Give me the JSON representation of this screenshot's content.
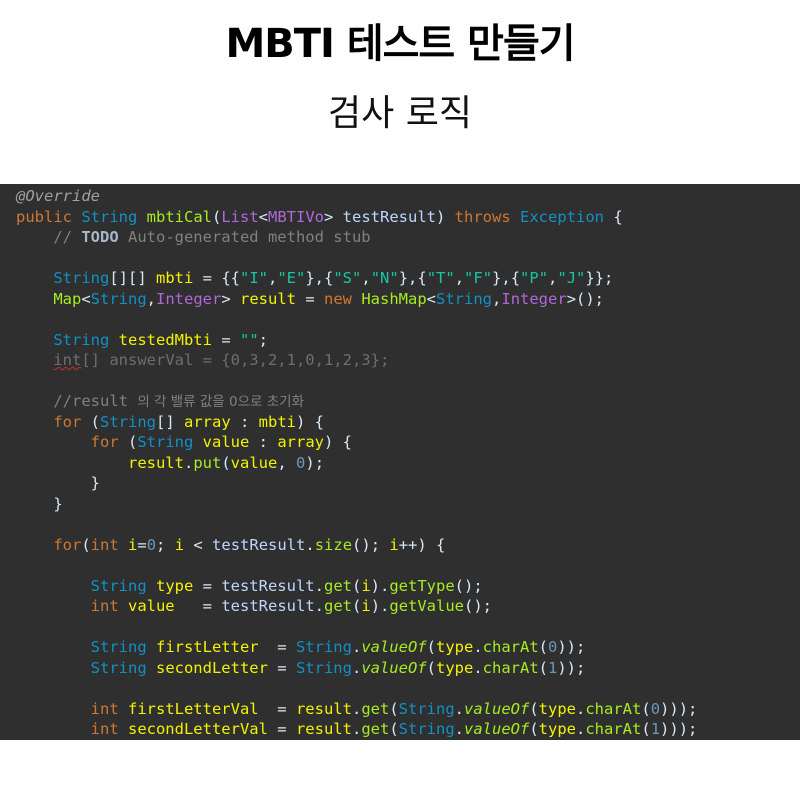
{
  "title": "MBTI 테스트 만들기",
  "subtitle": "검사 로직",
  "code": {
    "background": "#2f2f2f",
    "lines": [
      [
        {
          "c": "ann",
          "t": "@Override"
        }
      ],
      [
        {
          "c": "kw",
          "t": "public "
        },
        {
          "c": "ty",
          "t": "String "
        },
        {
          "c": "fn",
          "t": "mbtiCal"
        },
        {
          "c": "pl",
          "t": "("
        },
        {
          "c": "pink",
          "t": "List"
        },
        {
          "c": "pl",
          "t": "<"
        },
        {
          "c": "pink",
          "t": "MBTIVo"
        },
        {
          "c": "pl",
          "t": "> "
        },
        {
          "c": "gen",
          "t": "testResult"
        },
        {
          "c": "pl",
          "t": ") "
        },
        {
          "c": "kw",
          "t": "throws "
        },
        {
          "c": "ty",
          "t": "Exception "
        },
        {
          "c": "pl",
          "t": "{"
        }
      ],
      [
        {
          "c": "cm",
          "t": "    // "
        },
        {
          "c": "todo",
          "t": "TODO"
        },
        {
          "c": "cm",
          "t": " Auto-generated method stub"
        }
      ],
      [],
      [
        {
          "c": "pl",
          "t": "    "
        },
        {
          "c": "ty",
          "t": "String"
        },
        {
          "c": "pl",
          "t": "[][] "
        },
        {
          "c": "var",
          "t": "mbti"
        },
        {
          "c": "pl",
          "t": " = {{"
        },
        {
          "c": "str",
          "t": "\"I\""
        },
        {
          "c": "pl",
          "t": ","
        },
        {
          "c": "str",
          "t": "\"E\""
        },
        {
          "c": "pl",
          "t": "},{"
        },
        {
          "c": "str",
          "t": "\"S\""
        },
        {
          "c": "pl",
          "t": ","
        },
        {
          "c": "str",
          "t": "\"N\""
        },
        {
          "c": "pl",
          "t": "},{"
        },
        {
          "c": "str",
          "t": "\"T\""
        },
        {
          "c": "pl",
          "t": ","
        },
        {
          "c": "str",
          "t": "\"F\""
        },
        {
          "c": "pl",
          "t": "},{"
        },
        {
          "c": "str",
          "t": "\"P\""
        },
        {
          "c": "pl",
          "t": ","
        },
        {
          "c": "str",
          "t": "\"J\""
        },
        {
          "c": "pl",
          "t": "}};"
        }
      ],
      [
        {
          "c": "pl",
          "t": "    "
        },
        {
          "c": "fn",
          "t": "Map"
        },
        {
          "c": "pl",
          "t": "<"
        },
        {
          "c": "ty",
          "t": "String"
        },
        {
          "c": "pl",
          "t": ","
        },
        {
          "c": "pink",
          "t": "Integer"
        },
        {
          "c": "pl",
          "t": "> "
        },
        {
          "c": "var",
          "t": "result"
        },
        {
          "c": "pl",
          "t": " = "
        },
        {
          "c": "kw",
          "t": "new "
        },
        {
          "c": "fn",
          "t": "HashMap"
        },
        {
          "c": "pl",
          "t": "<"
        },
        {
          "c": "ty",
          "t": "String"
        },
        {
          "c": "pl",
          "t": ","
        },
        {
          "c": "pink",
          "t": "Integer"
        },
        {
          "c": "pl",
          "t": ">();"
        }
      ],
      [],
      [
        {
          "c": "pl",
          "t": "    "
        },
        {
          "c": "ty",
          "t": "String "
        },
        {
          "c": "var",
          "t": "testedMbti"
        },
        {
          "c": "pl",
          "t": " = "
        },
        {
          "c": "str",
          "t": "\"\""
        },
        {
          "c": "pl",
          "t": ";"
        }
      ],
      [
        {
          "c": "pl",
          "t": "    "
        },
        {
          "c": "dim sq",
          "t": "int"
        },
        {
          "c": "dim",
          "t": "[] answerVal = {0,3,2,1,0,1,2,3};"
        }
      ],
      [],
      [
        {
          "c": "cm",
          "t": "    //result "
        },
        {
          "c": "cmk",
          "t": "의 각 밸류 값을 0으로 초기화"
        }
      ],
      [
        {
          "c": "pl",
          "t": "    "
        },
        {
          "c": "kw",
          "t": "for "
        },
        {
          "c": "pl",
          "t": "("
        },
        {
          "c": "ty",
          "t": "String"
        },
        {
          "c": "pl",
          "t": "[] "
        },
        {
          "c": "var",
          "t": "array"
        },
        {
          "c": "pl",
          "t": " : "
        },
        {
          "c": "var",
          "t": "mbti"
        },
        {
          "c": "pl",
          "t": ") {"
        }
      ],
      [
        {
          "c": "pl",
          "t": "        "
        },
        {
          "c": "kw",
          "t": "for "
        },
        {
          "c": "pl",
          "t": "("
        },
        {
          "c": "ty",
          "t": "String "
        },
        {
          "c": "var",
          "t": "value"
        },
        {
          "c": "pl",
          "t": " : "
        },
        {
          "c": "var",
          "t": "array"
        },
        {
          "c": "pl",
          "t": ") {"
        }
      ],
      [
        {
          "c": "pl",
          "t": "            "
        },
        {
          "c": "var",
          "t": "result"
        },
        {
          "c": "pl",
          "t": "."
        },
        {
          "c": "fn",
          "t": "put"
        },
        {
          "c": "pl",
          "t": "("
        },
        {
          "c": "var",
          "t": "value"
        },
        {
          "c": "pl",
          "t": ", "
        },
        {
          "c": "num",
          "t": "0"
        },
        {
          "c": "pl",
          "t": ");"
        }
      ],
      [
        {
          "c": "pl",
          "t": "        }"
        }
      ],
      [
        {
          "c": "pl",
          "t": "    }"
        }
      ],
      [],
      [
        {
          "c": "pl",
          "t": "    "
        },
        {
          "c": "kw",
          "t": "for"
        },
        {
          "c": "pl",
          "t": "("
        },
        {
          "c": "kw",
          "t": "int "
        },
        {
          "c": "var",
          "t": "i"
        },
        {
          "c": "pl",
          "t": "="
        },
        {
          "c": "num",
          "t": "0"
        },
        {
          "c": "pl",
          "t": "; "
        },
        {
          "c": "var",
          "t": "i"
        },
        {
          "c": "pl",
          "t": " < "
        },
        {
          "c": "gen",
          "t": "testResult"
        },
        {
          "c": "pl",
          "t": "."
        },
        {
          "c": "fn",
          "t": "size"
        },
        {
          "c": "pl",
          "t": "(); "
        },
        {
          "c": "var",
          "t": "i"
        },
        {
          "c": "pl",
          "t": "++) {"
        }
      ],
      [],
      [
        {
          "c": "pl",
          "t": "        "
        },
        {
          "c": "ty",
          "t": "String "
        },
        {
          "c": "var",
          "t": "type"
        },
        {
          "c": "pl",
          "t": " = "
        },
        {
          "c": "gen",
          "t": "testResult"
        },
        {
          "c": "pl",
          "t": "."
        },
        {
          "c": "fn",
          "t": "get"
        },
        {
          "c": "pl",
          "t": "("
        },
        {
          "c": "var",
          "t": "i"
        },
        {
          "c": "pl",
          "t": ")."
        },
        {
          "c": "fn",
          "t": "getType"
        },
        {
          "c": "pl",
          "t": "();"
        }
      ],
      [
        {
          "c": "pl",
          "t": "        "
        },
        {
          "c": "kw",
          "t": "int "
        },
        {
          "c": "var",
          "t": "value"
        },
        {
          "c": "pl",
          "t": "   = "
        },
        {
          "c": "gen",
          "t": "testResult"
        },
        {
          "c": "pl",
          "t": "."
        },
        {
          "c": "fn",
          "t": "get"
        },
        {
          "c": "pl",
          "t": "("
        },
        {
          "c": "var",
          "t": "i"
        },
        {
          "c": "pl",
          "t": ")."
        },
        {
          "c": "fn",
          "t": "getValue"
        },
        {
          "c": "pl",
          "t": "();"
        }
      ],
      [],
      [
        {
          "c": "pl",
          "t": "        "
        },
        {
          "c": "ty",
          "t": "String "
        },
        {
          "c": "var",
          "t": "firstLetter"
        },
        {
          "c": "pl",
          "t": "  = "
        },
        {
          "c": "ty",
          "t": "String"
        },
        {
          "c": "pl",
          "t": "."
        },
        {
          "c": "fn ital",
          "t": "valueOf"
        },
        {
          "c": "pl",
          "t": "("
        },
        {
          "c": "var",
          "t": "type"
        },
        {
          "c": "pl",
          "t": "."
        },
        {
          "c": "fn",
          "t": "charAt"
        },
        {
          "c": "pl",
          "t": "("
        },
        {
          "c": "num",
          "t": "0"
        },
        {
          "c": "pl",
          "t": "));"
        }
      ],
      [
        {
          "c": "pl",
          "t": "        "
        },
        {
          "c": "ty",
          "t": "String "
        },
        {
          "c": "var",
          "t": "secondLetter"
        },
        {
          "c": "pl",
          "t": " = "
        },
        {
          "c": "ty",
          "t": "String"
        },
        {
          "c": "pl",
          "t": "."
        },
        {
          "c": "fn ital",
          "t": "valueOf"
        },
        {
          "c": "pl",
          "t": "("
        },
        {
          "c": "var",
          "t": "type"
        },
        {
          "c": "pl",
          "t": "."
        },
        {
          "c": "fn",
          "t": "charAt"
        },
        {
          "c": "pl",
          "t": "("
        },
        {
          "c": "num",
          "t": "1"
        },
        {
          "c": "pl",
          "t": "));"
        }
      ],
      [],
      [
        {
          "c": "pl",
          "t": "        "
        },
        {
          "c": "kw",
          "t": "int "
        },
        {
          "c": "var",
          "t": "firstLetterVal"
        },
        {
          "c": "pl",
          "t": "  = "
        },
        {
          "c": "var",
          "t": "result"
        },
        {
          "c": "pl",
          "t": "."
        },
        {
          "c": "fn",
          "t": "get"
        },
        {
          "c": "pl",
          "t": "("
        },
        {
          "c": "ty",
          "t": "String"
        },
        {
          "c": "pl",
          "t": "."
        },
        {
          "c": "fn ital",
          "t": "valueOf"
        },
        {
          "c": "pl",
          "t": "("
        },
        {
          "c": "var",
          "t": "type"
        },
        {
          "c": "pl",
          "t": "."
        },
        {
          "c": "fn",
          "t": "charAt"
        },
        {
          "c": "pl",
          "t": "("
        },
        {
          "c": "num",
          "t": "0"
        },
        {
          "c": "pl",
          "t": ")));"
        }
      ],
      [
        {
          "c": "pl",
          "t": "        "
        },
        {
          "c": "kw",
          "t": "int "
        },
        {
          "c": "var",
          "t": "secondLetterVal"
        },
        {
          "c": "pl",
          "t": " = "
        },
        {
          "c": "var",
          "t": "result"
        },
        {
          "c": "pl",
          "t": "."
        },
        {
          "c": "fn",
          "t": "get"
        },
        {
          "c": "pl",
          "t": "("
        },
        {
          "c": "ty",
          "t": "String"
        },
        {
          "c": "pl",
          "t": "."
        },
        {
          "c": "fn ital",
          "t": "valueOf"
        },
        {
          "c": "pl",
          "t": "("
        },
        {
          "c": "var",
          "t": "type"
        },
        {
          "c": "pl",
          "t": "."
        },
        {
          "c": "fn",
          "t": "charAt"
        },
        {
          "c": "pl",
          "t": "("
        },
        {
          "c": "num",
          "t": "1"
        },
        {
          "c": "pl",
          "t": ")));"
        }
      ]
    ]
  }
}
